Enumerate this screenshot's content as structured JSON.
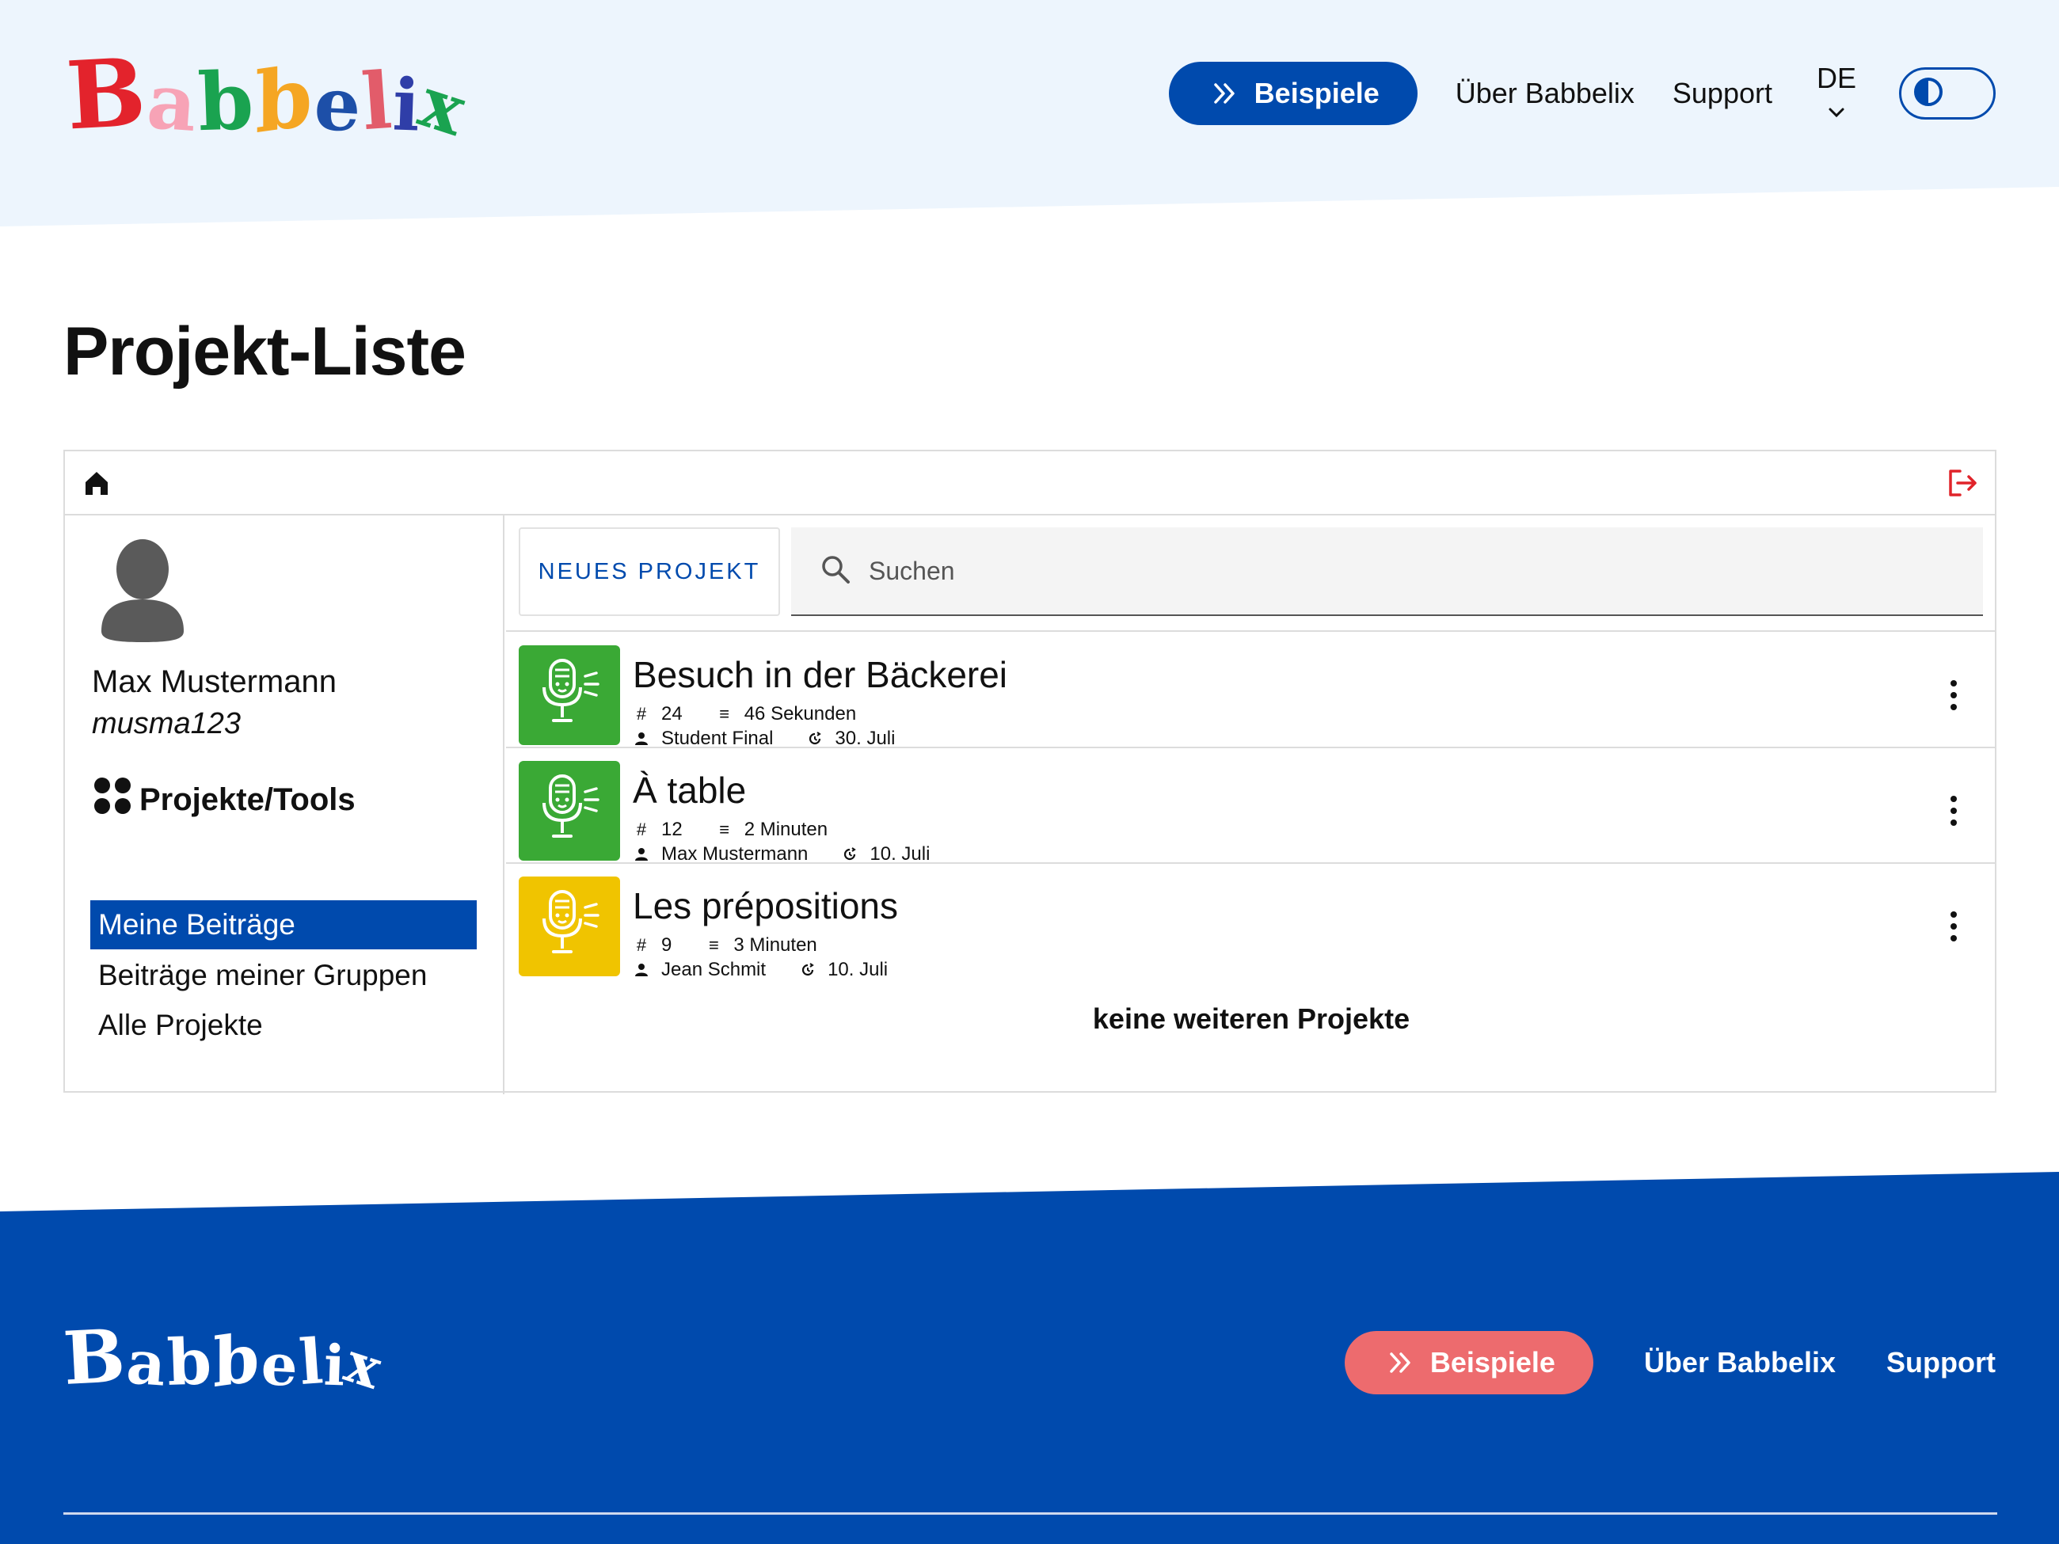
{
  "header": {
    "logo_text": "Babbelix",
    "nav": {
      "examples_label": "Beispiele",
      "about_label": "Über Babbelix",
      "support_label": "Support",
      "language": "DE"
    }
  },
  "page": {
    "title": "Projekt-Liste"
  },
  "user": {
    "name": "Max Mustermann",
    "handle": "musma123"
  },
  "sidebar": {
    "section_title": "Projekte/Tools",
    "items": [
      {
        "label": "Meine Beiträge",
        "active": true
      },
      {
        "label": "Beiträge meiner Gruppen",
        "active": false
      },
      {
        "label": "Alle Projekte",
        "active": false
      }
    ]
  },
  "toolbar": {
    "new_project_label": "NEUES PROJEKT",
    "search_placeholder": "Suchen"
  },
  "projects": [
    {
      "title": "Besuch in der Bäckerei",
      "count": "24",
      "duration": "46 Sekunden",
      "author": "Student Final",
      "date": "30. Juli",
      "color": "#3aa935"
    },
    {
      "title": "À table",
      "count": "12",
      "duration": "2 Minuten",
      "author": "Max Mustermann",
      "date": "10. Juli",
      "color": "#3aa935"
    },
    {
      "title": "Les prépositions",
      "count": "9",
      "duration": "3 Minuten",
      "author": "Jean Schmit",
      "date": "10. Juli",
      "color": "#f0c400"
    }
  ],
  "list_end_text": "keine weiteren Projekte",
  "footer": {
    "logo_text": "Babbelix",
    "examples_label": "Beispiele",
    "about_label": "Über Babbelix",
    "support_label": "Support"
  },
  "colors": {
    "brand_blue": "#004aad",
    "header_bg": "#edf5fd",
    "coral": "#ed6b6e",
    "logout_red": "#e0242a"
  }
}
